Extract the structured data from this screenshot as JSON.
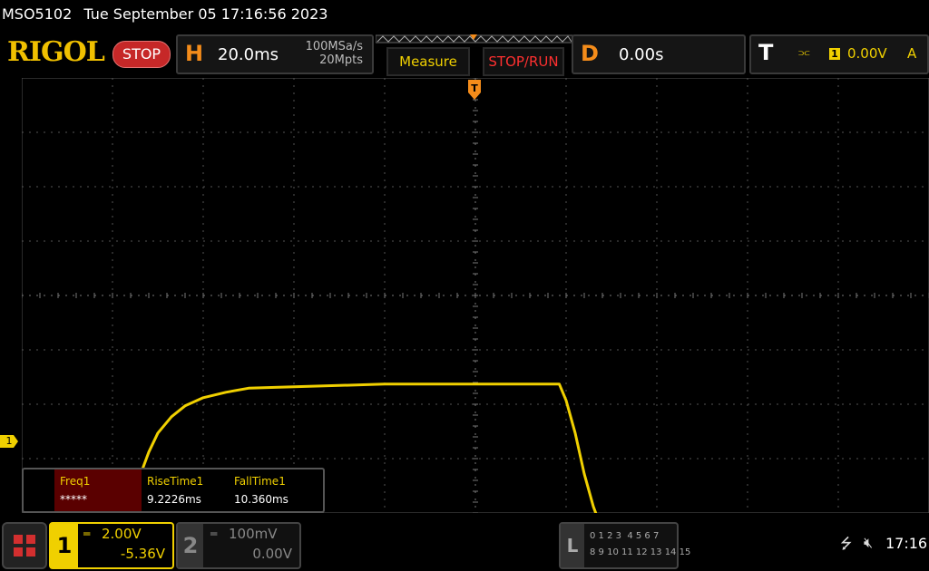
{
  "title_bar": {
    "model": "MSO5102",
    "datetime": "Tue September 05 17:16:56 2023"
  },
  "header": {
    "logo": "RIGOL",
    "run_state": "STOP",
    "horizontal": {
      "letter": "H",
      "timebase": "20.0ms",
      "sample_rate": "100MSa/s",
      "memory_depth": "20Mpts"
    },
    "measure_label": "Measure",
    "stoprun_label": "STOP/RUN",
    "delay": {
      "letter": "D",
      "value": "0.00s"
    },
    "trigger": {
      "letter": "T",
      "source_num": "1",
      "level": "0.00V",
      "mode": "A"
    }
  },
  "channel_marker": "1",
  "measurements": [
    {
      "label": "Freq1",
      "value": "*****"
    },
    {
      "label": "RiseTime1",
      "value": "9.2226ms"
    },
    {
      "label": "FallTime1",
      "value": "10.360ms"
    }
  ],
  "channels": {
    "ch1": {
      "num": "1",
      "coupling_icon": "═",
      "scale": "2.00V",
      "offset": "-5.36V"
    },
    "ch2": {
      "num": "2",
      "coupling_icon": "═",
      "scale": "100mV",
      "offset": "0.00V"
    }
  },
  "logic": {
    "letter": "L",
    "row1": "0 1 2 3  4 5 6 7",
    "row2": "8 9 10 11 12 13 14 15"
  },
  "status": {
    "usb_icon": "usb-icon",
    "speaker_icon": "speaker-muted-icon",
    "time": "17:16"
  },
  "colors": {
    "ch1": "#f0d000",
    "accent": "#f48c1a",
    "stop": "#c62828"
  },
  "chart_data": {
    "type": "line",
    "xlabel": "",
    "ylabel": "",
    "x_unit": "ms",
    "y_unit": "V",
    "x_div": 20,
    "y_div": 2.0,
    "grid": true,
    "series": [
      {
        "x": [
          -100,
          -80.5,
          -78,
          -76,
          -74,
          -72,
          -70,
          -67,
          -64,
          -60,
          -55,
          -50,
          -40,
          -30,
          -20,
          -10,
          0,
          10,
          18.5,
          20,
          22,
          24,
          26,
          28,
          30,
          32,
          34,
          36,
          38,
          40,
          42,
          45,
          50,
          55,
          60,
          70,
          80,
          100
        ],
        "y": [
          -5.36,
          -5.36,
          -4.2,
          -2.6,
          -1.3,
          -0.4,
          0.3,
          0.9,
          1.3,
          1.6,
          1.8,
          1.95,
          2.0,
          2.05,
          2.1,
          2.1,
          2.1,
          2.1,
          2.1,
          1.5,
          0.3,
          -1.2,
          -2.4,
          -3.3,
          -4.0,
          -4.5,
          -4.85,
          -5.05,
          -5.17,
          -5.24,
          -5.28,
          -5.3,
          -5.32,
          -5.34,
          -5.35,
          -5.36,
          -5.36,
          -5.36
        ]
      }
    ]
  }
}
